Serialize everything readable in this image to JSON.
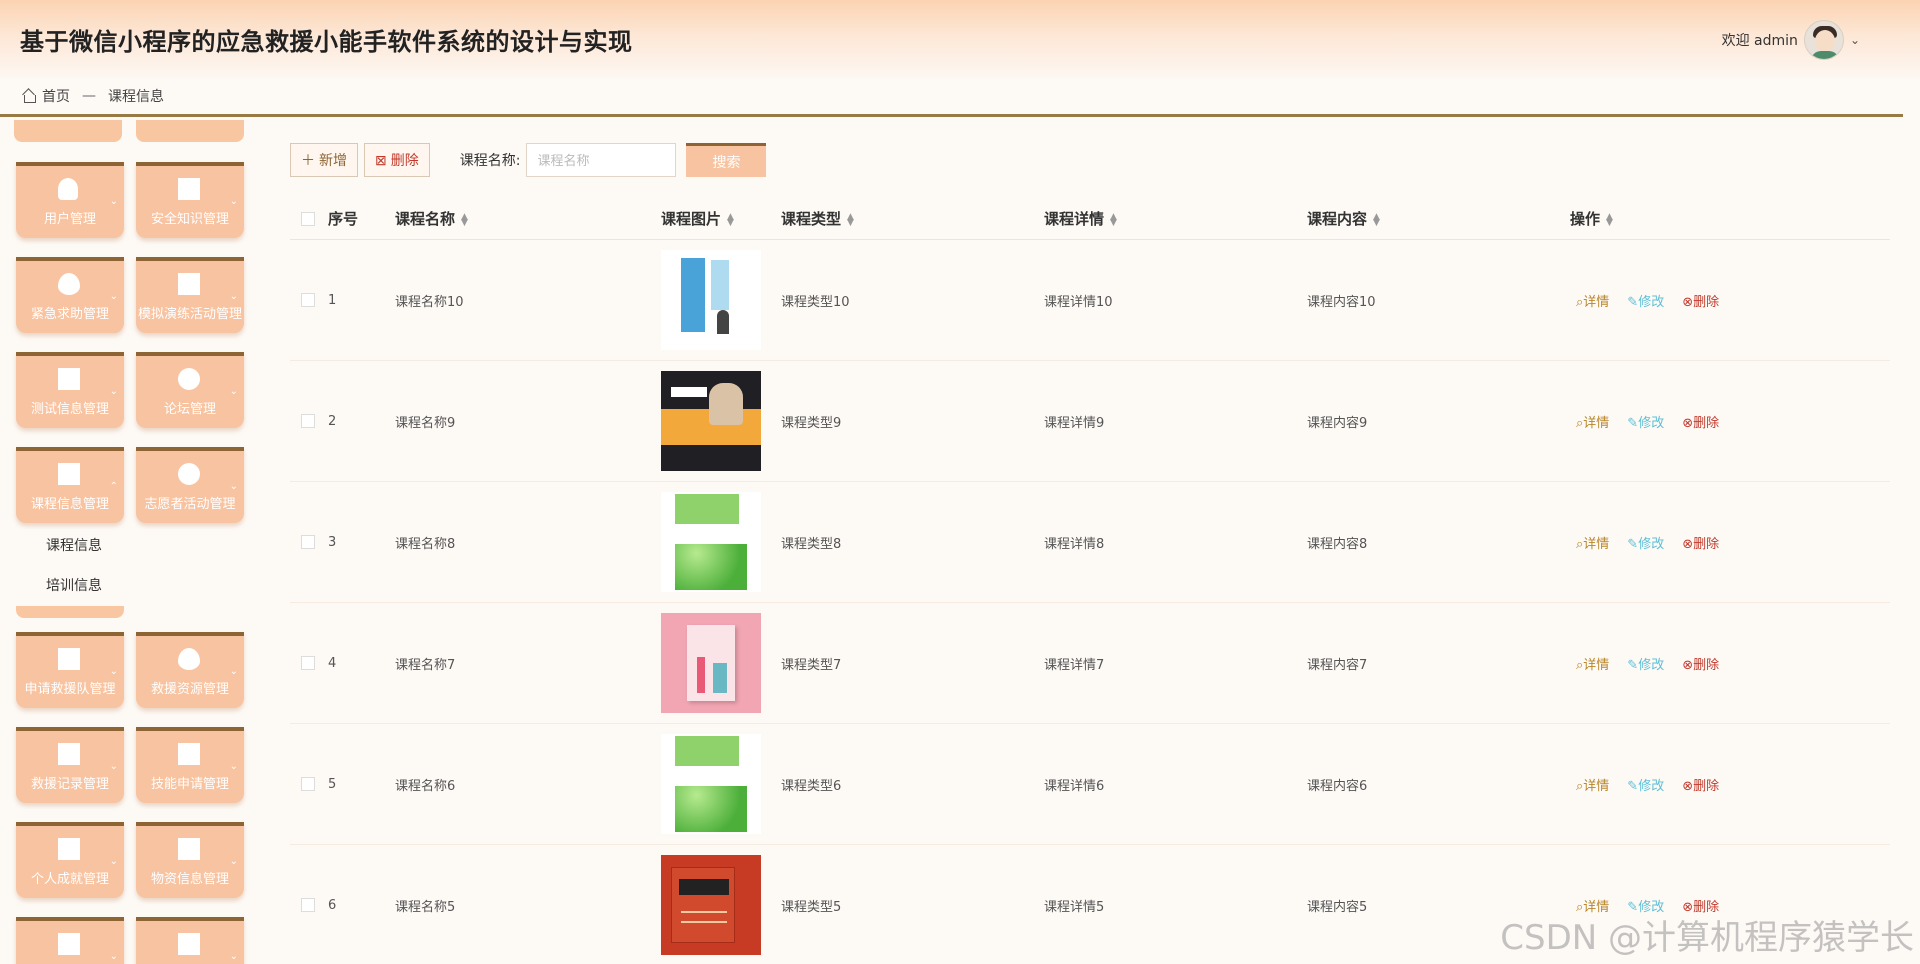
{
  "app": {
    "title": "基于微信小程序的应急救援小能手软件系统的设计与实现"
  },
  "user": {
    "welcome": "欢迎 admin"
  },
  "breadcrumb": {
    "home": "首页",
    "sep": "—",
    "current": "课程信息"
  },
  "sidebar": {
    "tiles": [
      {
        "label": "用户管理",
        "icon": "user-icon"
      },
      {
        "label": "安全知识管理",
        "icon": "grid-icon"
      },
      {
        "label": "紧急求助管理",
        "icon": "drop-icon"
      },
      {
        "label": "模拟演练活动管理",
        "icon": "shop-icon"
      },
      {
        "label": "测试信息管理",
        "icon": "doc-icon"
      },
      {
        "label": "论坛管理",
        "icon": "chat-icon"
      },
      {
        "label": "课程信息管理",
        "icon": "card-icon"
      },
      {
        "label": "志愿者活动管理",
        "icon": "clock-icon"
      },
      {
        "label": "申请救援队管理",
        "icon": "doc-icon"
      },
      {
        "label": "救援资源管理",
        "icon": "drop-icon"
      },
      {
        "label": "救援记录管理",
        "icon": "grid-icon"
      },
      {
        "label": "技能申请管理",
        "icon": "card-icon"
      },
      {
        "label": "个人成就管理",
        "icon": "folder-icon"
      },
      {
        "label": "物资信息管理",
        "icon": "grid-icon"
      }
    ],
    "submenu": [
      "课程信息",
      "培训信息"
    ]
  },
  "toolbar": {
    "add_label": "新增",
    "delete_label": "删除",
    "search_label": "课程名称:",
    "search_placeholder": "课程名称",
    "search_button": "搜索"
  },
  "table": {
    "headers": [
      "序号",
      "课程名称",
      "课程图片",
      "课程类型",
      "课程详情",
      "课程内容",
      "操作"
    ],
    "ops": {
      "detail": "详情",
      "edit": "修改",
      "delete": "删除"
    },
    "rows": [
      {
        "idx": "1",
        "name": "课程名称10",
        "type": "课程类型10",
        "detail": "课程详情10",
        "content": "课程内容10"
      },
      {
        "idx": "2",
        "name": "课程名称9",
        "type": "课程类型9",
        "detail": "课程详情9",
        "content": "课程内容9"
      },
      {
        "idx": "3",
        "name": "课程名称8",
        "type": "课程类型8",
        "detail": "课程详情8",
        "content": "课程内容8"
      },
      {
        "idx": "4",
        "name": "课程名称7",
        "type": "课程类型7",
        "detail": "课程详情7",
        "content": "课程内容7"
      },
      {
        "idx": "5",
        "name": "课程名称6",
        "type": "课程类型6",
        "detail": "课程详情6",
        "content": "课程内容6"
      },
      {
        "idx": "6",
        "name": "课程名称5",
        "type": "课程类型5",
        "detail": "课程详情5",
        "content": "课程内容5"
      }
    ]
  },
  "watermark": "CSDN @计算机程序猿学长",
  "colors": {
    "accent": "#f8c3a0",
    "accent_dark": "#8d6534",
    "danger": "#c0392b",
    "edit": "#5ec0d6"
  }
}
